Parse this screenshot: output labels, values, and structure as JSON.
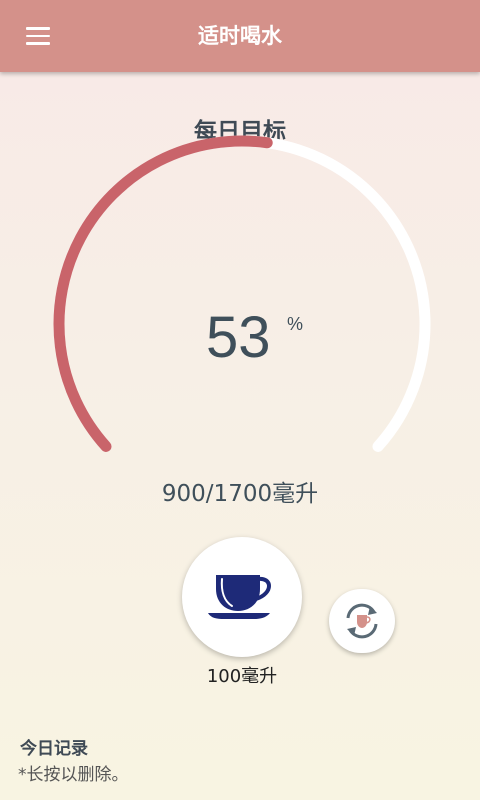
{
  "app": {
    "title": "适时喝水"
  },
  "goal": {
    "title": "每日目标",
    "percent": "53",
    "percent_sign": "%",
    "amount_text": "900/1700毫升",
    "consumed_ml": 900,
    "target_ml": 1700,
    "progress_fraction": 0.53
  },
  "cup": {
    "label": "100毫升"
  },
  "records": {
    "title": "今日记录",
    "hint": "*长按以删除。"
  },
  "icons": {
    "menu": "menu-icon",
    "cup": "coffee-cup-icon",
    "switch": "swap-cup-icon"
  },
  "colors": {
    "appbar": "#d4918a",
    "progress": "#c9646a",
    "track": "#ffffff",
    "cup": "#1e2a78"
  }
}
